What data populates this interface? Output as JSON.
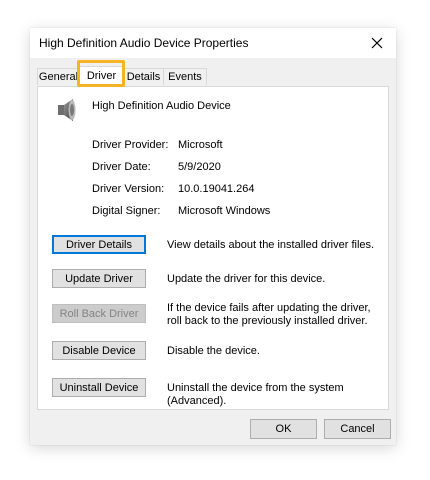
{
  "window": {
    "title": "High Definition Audio Device Properties",
    "close_icon": "close-icon"
  },
  "tabs": [
    {
      "label": "General",
      "active": false
    },
    {
      "label": "Driver",
      "active": true
    },
    {
      "label": "Details",
      "active": false
    },
    {
      "label": "Events",
      "active": false
    }
  ],
  "device": {
    "name": "High Definition Audio Device",
    "icon": "speaker-icon"
  },
  "properties": [
    {
      "label": "Driver Provider:",
      "value": "Microsoft"
    },
    {
      "label": "Driver Date:",
      "value": "5/9/2020"
    },
    {
      "label": "Driver Version:",
      "value": "10.0.19041.264"
    },
    {
      "label": "Digital Signer:",
      "value": "Microsoft Windows"
    }
  ],
  "actions": [
    {
      "label": "Driver Details",
      "description": "View details about the installed driver files.",
      "enabled": true,
      "focused": true
    },
    {
      "label": "Update Driver",
      "description": "Update the driver for this device.",
      "enabled": true,
      "focused": false
    },
    {
      "label": "Roll Back Driver",
      "description": "If the device fails after updating the driver, roll back to the previously installed driver.",
      "enabled": false,
      "focused": false
    },
    {
      "label": "Disable Device",
      "description": "Disable the device.",
      "enabled": true,
      "focused": false
    },
    {
      "label": "Uninstall Device",
      "description": "Uninstall the device from the system (Advanced).",
      "enabled": true,
      "focused": false
    }
  ],
  "footer": {
    "ok_label": "OK",
    "cancel_label": "Cancel"
  },
  "colors": {
    "highlight": "#f5b325",
    "focus": "#0078d7"
  }
}
